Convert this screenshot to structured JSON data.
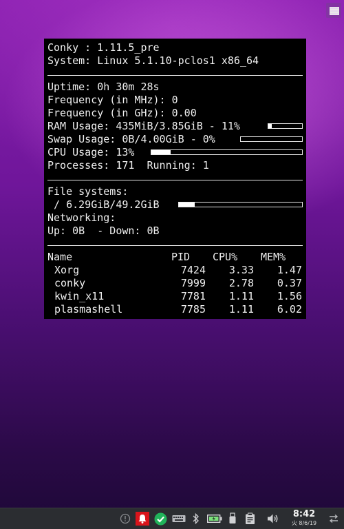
{
  "conky": {
    "header": [
      "Conky : 1.11.5_pre",
      "System: Linux 5.1.10-pclos1 x86_64"
    ],
    "stats": {
      "uptime": "Uptime: 0h 30m 28s",
      "freq_mhz": "Frequency (in MHz): 0",
      "freq_ghz": "Frequency (in GHz): 0.00",
      "ram": "RAM Usage: 435MiB/3.85GiB - 11%",
      "swap": "Swap Usage: 0B/4.00GiB - 0%",
      "cpu": "CPU Usage: 13%",
      "processes": "Processes: 171  Running: 1"
    },
    "ram_fraction": 0.11,
    "swap_fraction": 0.0,
    "cpu_fraction": 0.13,
    "fs": {
      "title": "File systems:",
      "root": " / 6.29GiB/49.2GiB",
      "root_fraction": 0.128
    },
    "net": {
      "title": "Networking:",
      "updown": "Up: 0B  - Down: 0B"
    },
    "table": {
      "headers": [
        "Name",
        "PID",
        "CPU%",
        "MEM%"
      ],
      "rows": [
        [
          "Xorg",
          "7424",
          "3.33",
          "1.47"
        ],
        [
          "conky",
          "7999",
          "2.78",
          "0.37"
        ],
        [
          "kwin_x11",
          "7781",
          "1.11",
          "1.56"
        ],
        [
          "plasmashell",
          "7785",
          "1.11",
          "6.02"
        ]
      ]
    }
  },
  "taskbar": {
    "time": "8:42",
    "date": "火 8/6/19",
    "icons": [
      "info-icon",
      "notification-bell-icon",
      "updates-check-icon",
      "keyboard-icon",
      "bluetooth-icon",
      "battery-icon",
      "usb-drive-icon",
      "clipboard-icon",
      "volume-icon",
      "network-settings-icon"
    ]
  }
}
